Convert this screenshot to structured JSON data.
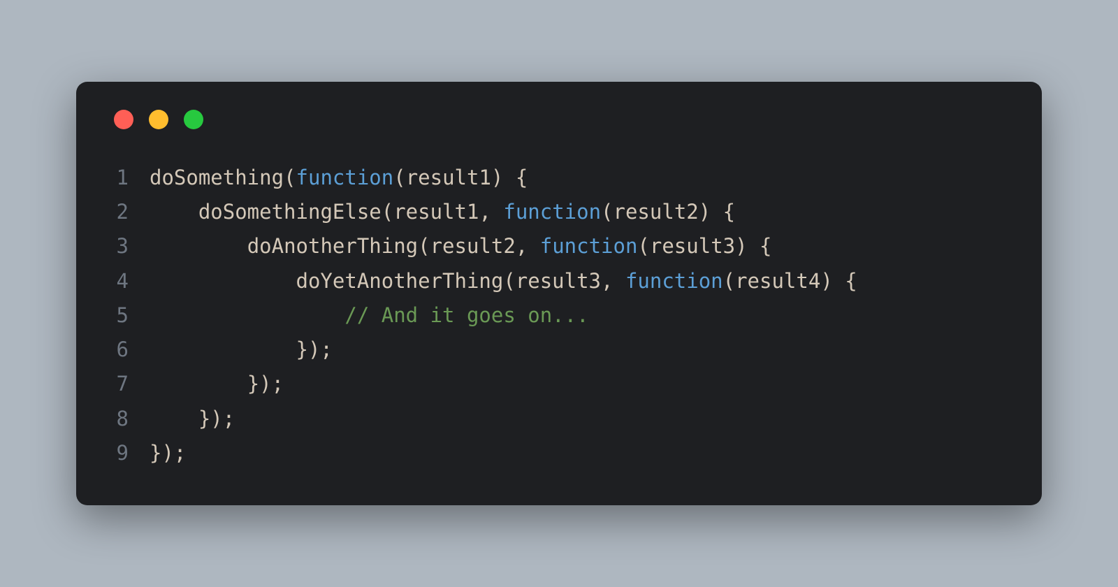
{
  "colors": {
    "background": "#aeb7c0",
    "window": "#1e1f22",
    "red": "#ff5f56",
    "yellow": "#ffbd2e",
    "green": "#27c93f",
    "lineno": "#6e7681",
    "text": "#d4c8b8",
    "keyword": "#5c9fd6",
    "comment": "#6a9955"
  },
  "code": {
    "lines": [
      {
        "num": "1",
        "indent": "",
        "tokens": [
          {
            "type": "fn",
            "text": "doSomething"
          },
          {
            "type": "punct",
            "text": "("
          },
          {
            "type": "keyword",
            "text": "function"
          },
          {
            "type": "punct",
            "text": "("
          },
          {
            "type": "param",
            "text": "result1"
          },
          {
            "type": "punct",
            "text": ") {"
          }
        ]
      },
      {
        "num": "2",
        "indent": "    ",
        "tokens": [
          {
            "type": "fn",
            "text": "doSomethingElse"
          },
          {
            "type": "punct",
            "text": "("
          },
          {
            "type": "param",
            "text": "result1"
          },
          {
            "type": "punct",
            "text": ", "
          },
          {
            "type": "keyword",
            "text": "function"
          },
          {
            "type": "punct",
            "text": "("
          },
          {
            "type": "param",
            "text": "result2"
          },
          {
            "type": "punct",
            "text": ") {"
          }
        ]
      },
      {
        "num": "3",
        "indent": "        ",
        "tokens": [
          {
            "type": "fn",
            "text": "doAnotherThing"
          },
          {
            "type": "punct",
            "text": "("
          },
          {
            "type": "param",
            "text": "result2"
          },
          {
            "type": "punct",
            "text": ", "
          },
          {
            "type": "keyword",
            "text": "function"
          },
          {
            "type": "punct",
            "text": "("
          },
          {
            "type": "param",
            "text": "result3"
          },
          {
            "type": "punct",
            "text": ") {"
          }
        ]
      },
      {
        "num": "4",
        "indent": "            ",
        "tokens": [
          {
            "type": "fn",
            "text": "doYetAnotherThing"
          },
          {
            "type": "punct",
            "text": "("
          },
          {
            "type": "param",
            "text": "result3"
          },
          {
            "type": "punct",
            "text": ", "
          },
          {
            "type": "keyword",
            "text": "function"
          },
          {
            "type": "punct",
            "text": "("
          },
          {
            "type": "param",
            "text": "result4"
          },
          {
            "type": "punct",
            "text": ") {"
          }
        ]
      },
      {
        "num": "5",
        "indent": "                ",
        "tokens": [
          {
            "type": "comment",
            "text": "// And it goes on..."
          }
        ]
      },
      {
        "num": "6",
        "indent": "            ",
        "tokens": [
          {
            "type": "punct",
            "text": "});"
          }
        ]
      },
      {
        "num": "7",
        "indent": "        ",
        "tokens": [
          {
            "type": "punct",
            "text": "});"
          }
        ]
      },
      {
        "num": "8",
        "indent": "    ",
        "tokens": [
          {
            "type": "punct",
            "text": "});"
          }
        ]
      },
      {
        "num": "9",
        "indent": "",
        "tokens": [
          {
            "type": "punct",
            "text": "});"
          }
        ]
      }
    ]
  }
}
